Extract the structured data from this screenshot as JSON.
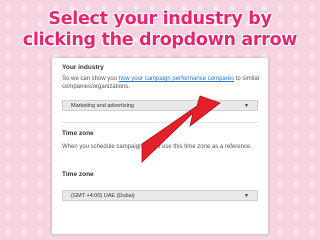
{
  "headline": {
    "line1": "Select your industry by",
    "line2": "clicking the dropdown arrow"
  },
  "industry": {
    "label": "Your industry",
    "desc_prefix": "So we can show you ",
    "desc_link": "how your campaign performance compares",
    "desc_suffix": " to similar companies/organizations.",
    "selected": "Marketing and advertising",
    "chevron_icon": "chevron-down-icon"
  },
  "timezone": {
    "section_label": "Time zone",
    "desc": "When you schedule campaigns, we'll use this time zone as a reference.",
    "field_label": "Time zone",
    "selected": "(GMT +4:00) UAE (Dubai)",
    "chevron_icon": "chevron-down-icon"
  },
  "colors": {
    "headline": "#e8266f",
    "arrow": "#e4202a",
    "background": "#f6d3e1",
    "link": "#2a74c5"
  }
}
